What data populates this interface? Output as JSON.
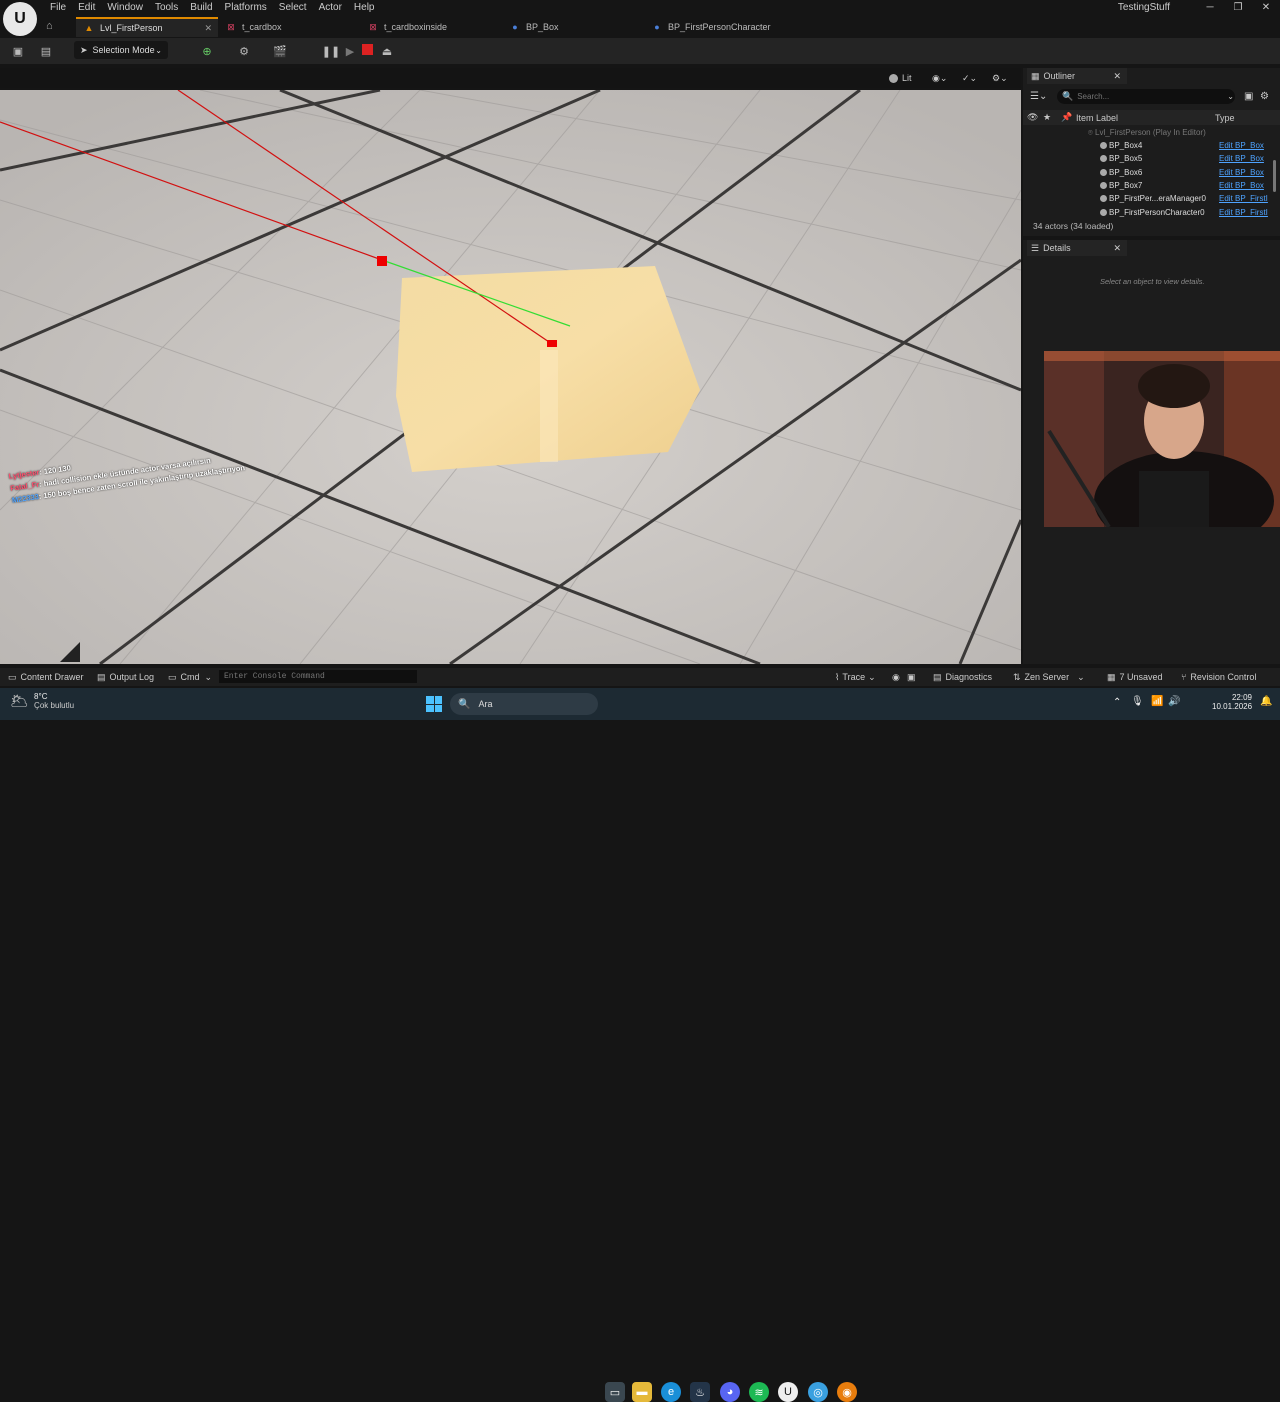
{
  "menu": [
    "File",
    "Edit",
    "Window",
    "Tools",
    "Build",
    "Platforms",
    "Select",
    "Actor",
    "Help"
  ],
  "window_title": "TestingStuff",
  "tabs": [
    {
      "label": "Lvl_FirstPerson",
      "active": true
    },
    {
      "label": "t_cardbox"
    },
    {
      "label": "t_cardboxinside"
    },
    {
      "label": "BP_Box"
    },
    {
      "label": "BP_FirstPersonCharacter"
    }
  ],
  "toolbar": {
    "selection_mode": "Selection Mode"
  },
  "viewport": {
    "lit_label": "Lit"
  },
  "chat": [
    {
      "user": "Lytjester",
      "msg": "120 130",
      "color": "#ff4d6d"
    },
    {
      "user": "Fatal_Fr",
      "msg": "hadi collision ekle üstünde actor varsa açılırsın",
      "color": "#ff4d6d"
    },
    {
      "user": "M22333",
      "msg": "150 boş bence zaten scroll ile yakınlaştırıp uzaklaştırıyon",
      "color": "#4ea3ff"
    }
  ],
  "outliner": {
    "title": "Outliner",
    "search_placeholder": "Search...",
    "col_label": "Item Label",
    "col_type": "Type",
    "root": "Lvl_FirstPerson (Play In Editor)",
    "rows": [
      {
        "label": "BP_Box4",
        "type": "Edit BP_Box"
      },
      {
        "label": "BP_Box5",
        "type": "Edit BP_Box"
      },
      {
        "label": "BP_Box6",
        "type": "Edit BP_Box"
      },
      {
        "label": "BP_Box7",
        "type": "Edit BP_Box"
      },
      {
        "label": "BP_FirstPer...eraManager0",
        "type": "Edit BP_FirstI"
      },
      {
        "label": "BP_FirstPersonCharacter0",
        "type": "Edit BP_FirstI"
      }
    ],
    "count": "34 actors (34 loaded)"
  },
  "details": {
    "title": "Details",
    "empty": "Select an object to view details."
  },
  "statusbar": {
    "content_drawer": "Content Drawer",
    "output_log": "Output Log",
    "cmd": "Cmd",
    "console_placeholder": "Enter Console Command",
    "trace": "Trace",
    "diagnostics": "Diagnostics",
    "zen": "Zen Server",
    "unsaved": "7 Unsaved",
    "revision": "Revision Control"
  },
  "taskbar": {
    "weather_temp": "8°C",
    "weather_desc": "Çok bulutlu",
    "search": "Ara",
    "time": "22:09",
    "date": "10.01.2026"
  }
}
